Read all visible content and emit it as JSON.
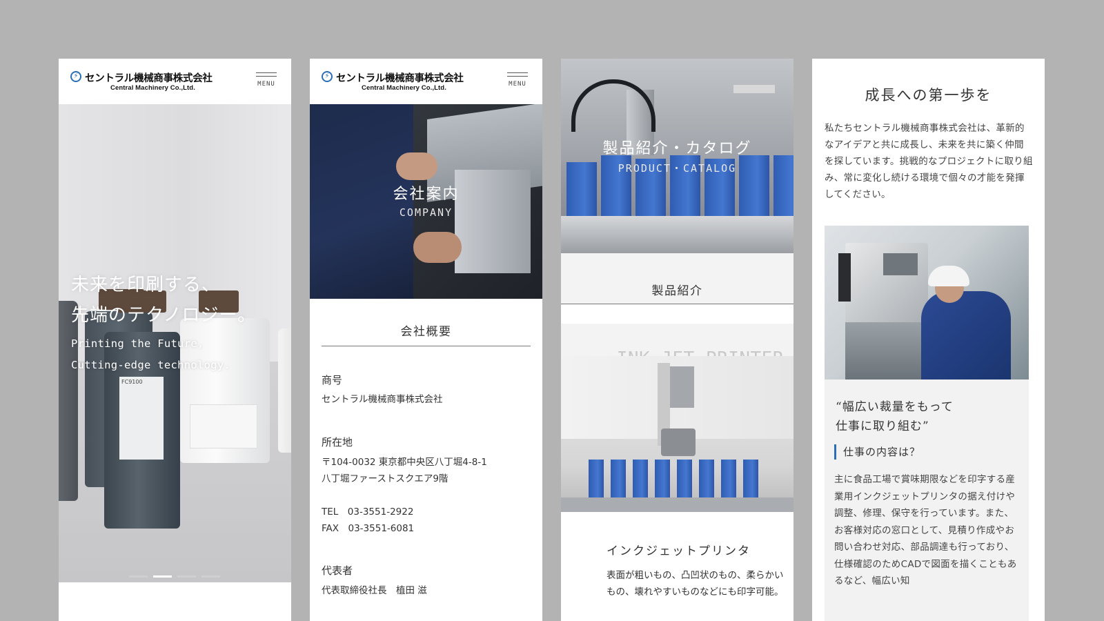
{
  "brand": {
    "name_jp": "セントラル機械商事株式会社",
    "name_en": "Central Machinery Co.,Ltd.",
    "accent": "#2a6fb5"
  },
  "menu_label": "MENU",
  "panel1": {
    "headline": [
      "未来を印刷する、",
      "先端のテクノロジー。"
    ],
    "subline": [
      "Printing the Future,",
      "Cutting-edge technology."
    ],
    "bottle_label": "FC9100",
    "slide_count": 4,
    "active_slide": 2
  },
  "panel2": {
    "hero_jp": "会社案内",
    "hero_en": "COMPANY",
    "section_title": "会社概要",
    "rows": [
      {
        "term": "商号",
        "lines": [
          "セントラル機械商事株式会社"
        ]
      },
      {
        "term": "所在地",
        "lines": [
          "〒104-0032 東京都中央区八丁堀4-8-1",
          "八丁堀ファーストスクエア9階",
          "",
          "TEL　03-3551-2922",
          "FAX　03-3551-6081"
        ]
      },
      {
        "term": "代表者",
        "lines": [
          "代表取締役社長　植田 滋"
        ]
      }
    ]
  },
  "panel3": {
    "hero_jp": "製品紹介・カタログ",
    "hero_en": "PRODUCT・CATALOG",
    "section_title": "製品紹介",
    "category_en": "INK-JET PRINTER",
    "product_title": "インクジェットプリンタ",
    "product_text": "表面が粗いもの、凸凹状のもの、柔らかいもの、壊れやすいものなどにも印字可能。"
  },
  "panel4": {
    "title": "成長への第一歩を",
    "intro": "私たちセントラル機械商事株式会社は、革新的なアイデアと共に成長し、未来を共に築く仲間を探しています。挑戦的なプロジェクトに取り組み、常に変化し続ける環境で個々の才能を発揮してください。",
    "quote": [
      "“幅広い裁量をもって",
      "仕事に取り組む”"
    ],
    "question": "仕事の内容は？",
    "body": "主に食品工場で賞味期限などを印字する産業用インクジェットプリンタの据え付けや調整、修理、保守を行っています。また、お客様対応の窓口として、見積り作成やお問い合わせ対応、部品調達も行っており、仕様確認のためCADで図面を描くこともあるなど、幅広い知"
  }
}
